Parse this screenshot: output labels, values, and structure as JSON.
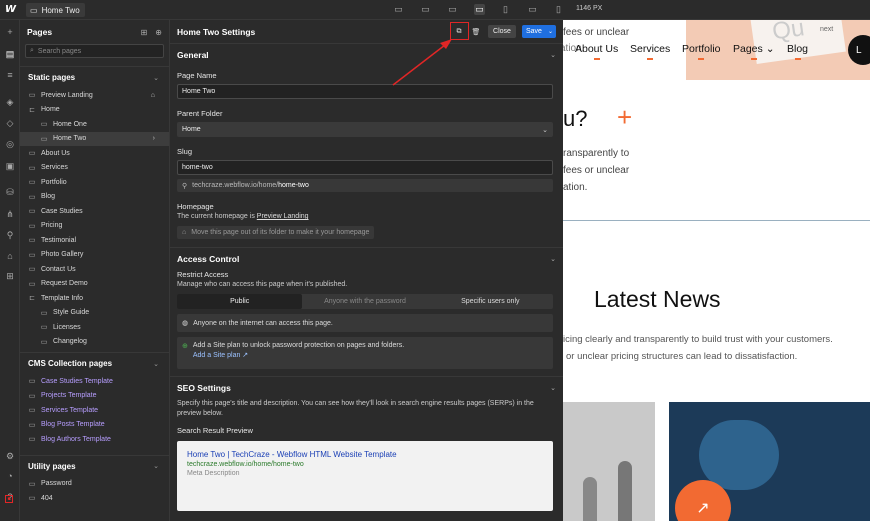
{
  "topbar": {
    "page_name": "Home Two",
    "width_readout": "1146 PX"
  },
  "pages_panel": {
    "title": "Pages",
    "search_placeholder": "Search pages",
    "static_title": "Static pages",
    "static_pages": [
      {
        "label": "Preview Landing",
        "level": 0,
        "icon": "page-icon"
      },
      {
        "label": "Home",
        "level": 0,
        "icon": "folder-icon"
      },
      {
        "label": "Home One",
        "level": 1,
        "icon": "page-icon"
      },
      {
        "label": "Home Two",
        "level": 1,
        "icon": "page-icon",
        "selected": true
      },
      {
        "label": "About Us",
        "level": 0,
        "icon": "page-icon"
      },
      {
        "label": "Services",
        "level": 0,
        "icon": "page-icon"
      },
      {
        "label": "Portfolio",
        "level": 0,
        "icon": "page-icon"
      },
      {
        "label": "Blog",
        "level": 0,
        "icon": "page-icon"
      },
      {
        "label": "Case Studies",
        "level": 0,
        "icon": "page-icon"
      },
      {
        "label": "Pricing",
        "level": 0,
        "icon": "page-icon"
      },
      {
        "label": "Testimonial",
        "level": 0,
        "icon": "page-icon"
      },
      {
        "label": "Photo Gallery",
        "level": 0,
        "icon": "page-icon"
      },
      {
        "label": "Contact Us",
        "level": 0,
        "icon": "page-icon"
      },
      {
        "label": "Request Demo",
        "level": 0,
        "icon": "page-icon"
      },
      {
        "label": "Template Info",
        "level": 0,
        "icon": "folder-icon"
      },
      {
        "label": "Style Guide",
        "level": 1,
        "icon": "page-icon"
      },
      {
        "label": "Licenses",
        "level": 1,
        "icon": "page-icon"
      },
      {
        "label": "Changelog",
        "level": 1,
        "icon": "page-icon"
      }
    ],
    "cms_title": "CMS Collection pages",
    "cms_pages": [
      "Case Studies Template",
      "Projects Template",
      "Services Template",
      "Blog Posts Template",
      "Blog Authors Template"
    ],
    "utility_title": "Utility pages",
    "utility_pages": [
      "Password",
      "404"
    ]
  },
  "settings": {
    "title": "Home Two Settings",
    "close_label": "Close",
    "save_label": "Save",
    "general": {
      "title": "General",
      "page_name_label": "Page Name",
      "page_name_value": "Home Two",
      "parent_folder_label": "Parent Folder",
      "parent_folder_value": "Home",
      "slug_label": "Slug",
      "slug_value": "home-two",
      "url_prefix": "techcraze.webflow.io/home/",
      "url_slug": "home-two",
      "homepage_label": "Homepage",
      "homepage_text": "The current homepage is",
      "homepage_link": "Preview Landing",
      "move_button": "Move this page out of its folder to make it your homepage"
    },
    "access": {
      "title": "Access Control",
      "restrict_label": "Restrict Access",
      "restrict_desc": "Manage who can access this page when it's published.",
      "options": [
        "Public",
        "Anyone with the password",
        "Specific users only"
      ],
      "public_note": "Anyone on the internet can access this page.",
      "upsell_text": "Add a Site plan to unlock password protection on pages and folders.",
      "upsell_link": "Add a Site plan ↗"
    },
    "seo": {
      "title": "SEO Settings",
      "desc": "Specify this page's title and description. You can see how they'll look in search engine results pages (SERPs) in the preview below.",
      "preview_label": "Search Result Preview",
      "serp_title": "Home Two | TechCraze - Webflow HTML Website Template",
      "serp_url": "techcraze.webflow.io/home/home-two",
      "serp_desc": "Meta Description"
    }
  },
  "site": {
    "nav": [
      "About Us",
      "Services",
      "Portfolio",
      "Pages",
      "Blog"
    ],
    "next_label": "next",
    "partial_heading": "u?",
    "partial_lines_top": [
      "fees or unclear",
      "ation."
    ],
    "partial_lines_mid": [
      "ransparently to",
      "fees or unclear",
      "ation."
    ],
    "latest_news": "Latest News",
    "news_line1": "icing clearly and transparently to build trust with your customers.",
    "news_line2": "or unclear pricing structures can lead to dissatisfaction."
  },
  "colors": {
    "accent_blue": "#1f6fe0",
    "highlight_red": "#e12626",
    "brand_orange": "#f26a32"
  }
}
